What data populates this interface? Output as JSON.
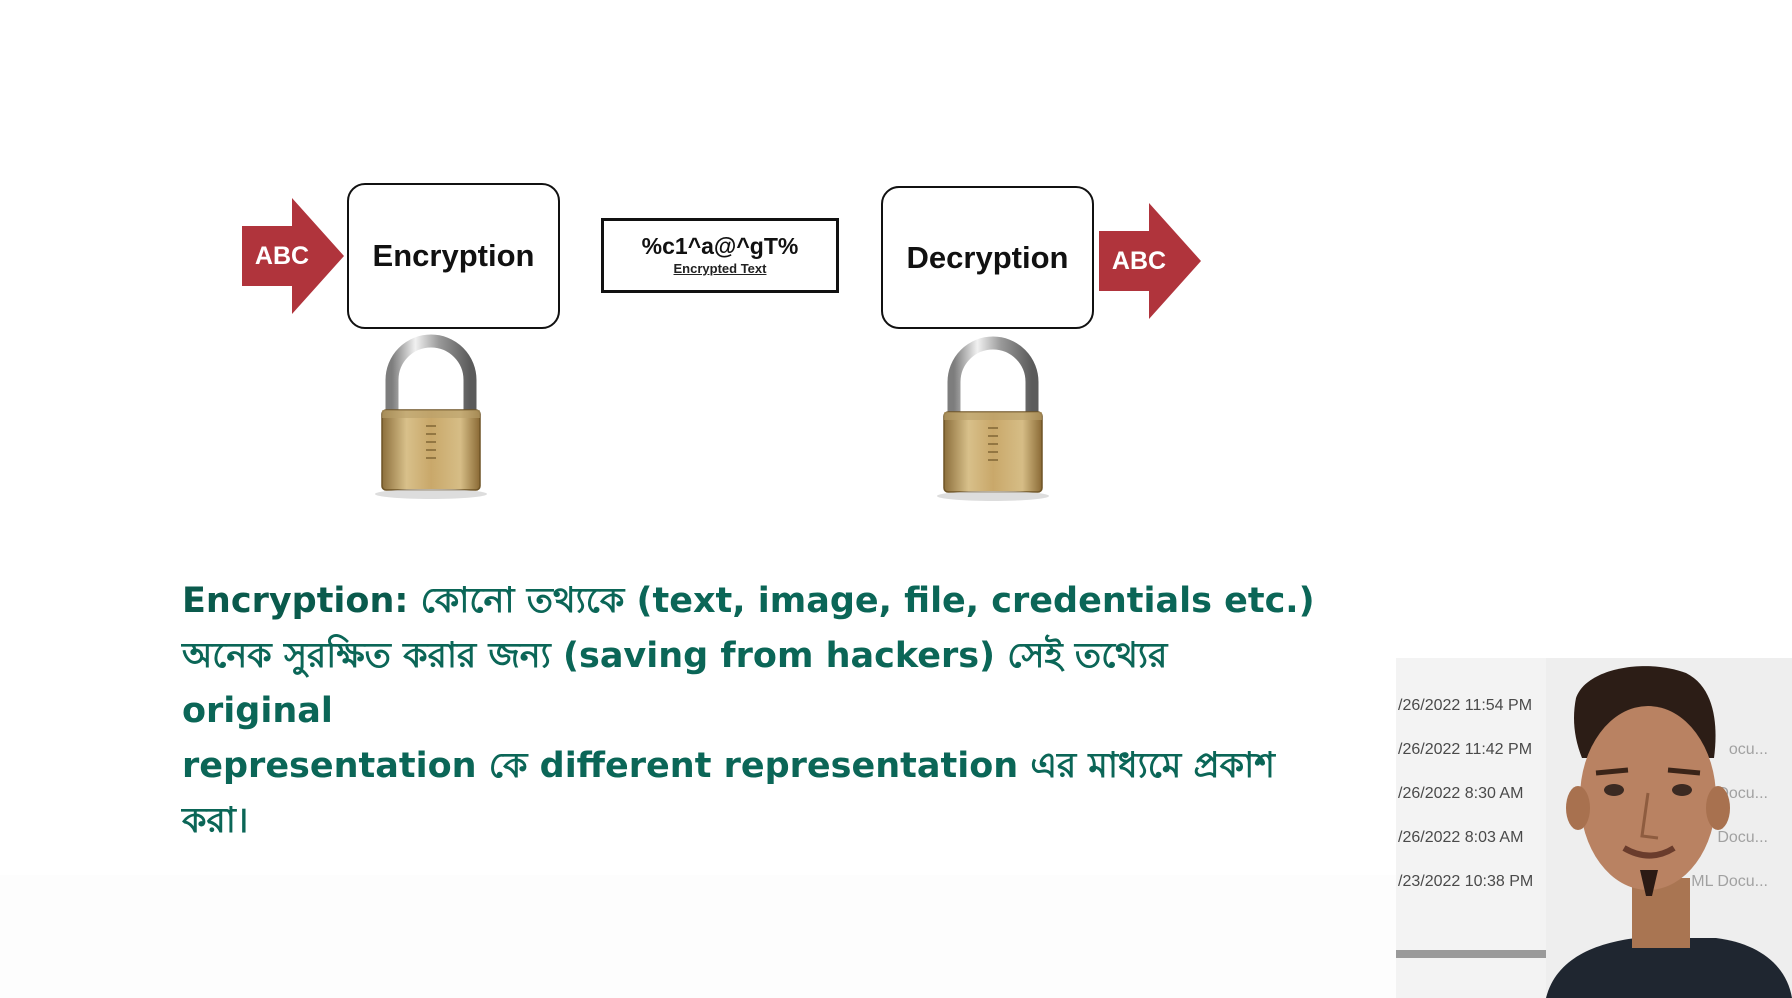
{
  "diagram": {
    "input_label": "ABC",
    "encrypt_label": "Encryption",
    "cipher_text": "%c1^a@^gT%",
    "cipher_caption": "Encrypted Text",
    "decrypt_label": "Decryption",
    "output_label": "ABC",
    "colors": {
      "arrow": "#b0343c",
      "box_border": "#111111"
    }
  },
  "definition": {
    "term": "Encryption:",
    "line1": " কোনো তথ্যকে (text, image, file, credentials etc.)",
    "line2": "অনেক সুরক্ষিত করার জন্য (saving from hackers) সেই তথ্যের original",
    "line3": "representation কে different representation এর মাধ্যমে প্রকাশ করা।",
    "color": "#0b6657"
  },
  "file_list": [
    {
      "date": "/26/2022 11:54 PM",
      "type": ""
    },
    {
      "date": "/26/2022 11:42 PM",
      "type": "ocu..."
    },
    {
      "date": "/26/2022 8:30 AM",
      "type": "Docu..."
    },
    {
      "date": "/26/2022 8:03 AM",
      "type": "Docu..."
    },
    {
      "date": "/23/2022 10:38 PM",
      "type": "ML Docu..."
    }
  ]
}
